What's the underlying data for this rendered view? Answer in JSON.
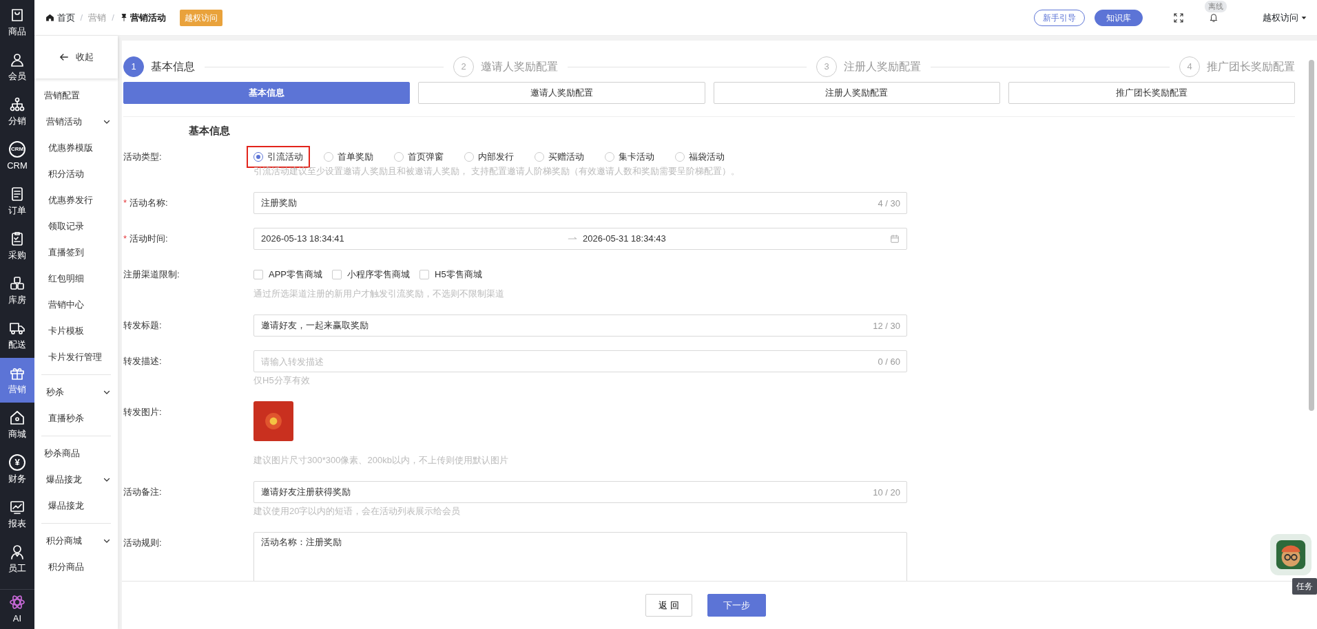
{
  "rail": {
    "items": [
      {
        "label": "商品",
        "selected": false
      },
      {
        "label": "会员",
        "selected": false
      },
      {
        "label": "分销",
        "selected": false
      },
      {
        "label": "CRM",
        "icon_text": "CRM",
        "selected": false
      },
      {
        "label": "订单",
        "selected": false
      },
      {
        "label": "采购",
        "selected": false
      },
      {
        "label": "库房",
        "selected": false
      },
      {
        "label": "配送",
        "selected": false
      },
      {
        "label": "营销",
        "selected": true
      },
      {
        "label": "商城",
        "selected": false
      },
      {
        "label": "财务",
        "icon_text": "¥",
        "selected": false
      },
      {
        "label": "报表",
        "selected": false
      },
      {
        "label": "员工",
        "selected": false
      }
    ],
    "ai": "AI"
  },
  "breadcrumb": {
    "separator": "/",
    "items": [
      {
        "label": "首页",
        "kind": "home"
      },
      {
        "label": "营销",
        "kind": "plain"
      },
      {
        "label": "营销活动",
        "kind": "current"
      }
    ],
    "badge": "越权访问"
  },
  "topbar": {
    "guide": "新手引导",
    "knowledge": "知识库",
    "status": "离线",
    "user": "越权访问"
  },
  "submenu": {
    "collapse": "收起",
    "items": [
      {
        "kind": "header",
        "label": "营销配置"
      },
      {
        "kind": "group",
        "label": "营销活动",
        "expanded": true,
        "children": [
          "优惠券模版",
          "积分活动",
          "优惠券发行",
          "领取记录",
          "直播签到",
          "红包明细",
          "营销中心",
          "卡片模板",
          "卡片发行管理"
        ]
      },
      {
        "kind": "group",
        "label": "秒杀",
        "expanded": true,
        "children": [
          "直播秒杀"
        ]
      },
      {
        "kind": "header",
        "label": "秒杀商品"
      },
      {
        "kind": "group",
        "label": "爆品接龙",
        "expanded": true,
        "children": [
          "爆品接龙"
        ]
      },
      {
        "kind": "group",
        "label": "积分商城",
        "expanded": true,
        "children": [
          "积分商品"
        ]
      }
    ]
  },
  "steps": [
    {
      "number": "1",
      "label": "基本信息",
      "selected": true
    },
    {
      "number": "2",
      "label": "邀请人奖励配置",
      "selected": false
    },
    {
      "number": "3",
      "label": "注册人奖励配置",
      "selected": false
    },
    {
      "number": "4",
      "label": "推广团长奖励配置",
      "selected": false
    }
  ],
  "tabs": [
    {
      "label": "基本信息",
      "selected": true
    },
    {
      "label": "邀请人奖励配置",
      "selected": false
    },
    {
      "label": "注册人奖励配置",
      "selected": false
    },
    {
      "label": "推广团长奖励配置",
      "selected": false
    }
  ],
  "section_title": "基本信息",
  "required_mark": "*",
  "fields": [
    {
      "kind": "radio",
      "label": "活动类型:",
      "required": false,
      "options": [
        {
          "label": "引流活动",
          "selected": true,
          "highlighted": true
        },
        {
          "label": "首单奖励",
          "selected": false,
          "highlighted": false
        },
        {
          "label": "首页弹窗",
          "selected": false,
          "highlighted": false
        },
        {
          "label": "内部发行",
          "selected": false,
          "highlighted": false
        },
        {
          "label": "买赠活动",
          "selected": false,
          "highlighted": false
        },
        {
          "label": "集卡活动",
          "selected": false,
          "highlighted": false
        },
        {
          "label": "福袋活动",
          "selected": false,
          "highlighted": false
        }
      ],
      "hint": "引流活动建议至少设置邀请人奖励且和被邀请人奖励， 支持配置邀请人阶梯奖励（有效邀请人数和奖励需要呈阶梯配置）。"
    },
    {
      "kind": "text",
      "label": "活动名称:",
      "required": true,
      "value": "注册奖励",
      "counter": "4 / 30"
    },
    {
      "kind": "daterange",
      "label": "活动时间:",
      "required": true,
      "start": "2026-05-13 18:34:41",
      "end": "2026-05-31 18:34:43"
    },
    {
      "kind": "checkbox",
      "label": "注册渠道限制:",
      "required": false,
      "options": [
        {
          "label": "APP零售商城",
          "checked": false
        },
        {
          "label": "小程序零售商城",
          "checked": false
        },
        {
          "label": "H5零售商城",
          "checked": false
        }
      ],
      "hint": "通过所选渠道注册的新用户才触发引流奖励，不选则不限制渠道"
    },
    {
      "kind": "text",
      "label": "转发标题:",
      "required": false,
      "value": "邀请好友，一起来赢取奖励",
      "counter": "12 / 30"
    },
    {
      "kind": "text",
      "label": "转发描述:",
      "required": false,
      "placeholder": "请输入转发描述",
      "counter": "0 / 60",
      "hint": "仅H5分享有效"
    },
    {
      "kind": "image",
      "label": "转发图片:",
      "required": false,
      "hint": "建议图片尺寸300*300像素、200kb以内，不上传则使用默认图片"
    },
    {
      "kind": "text",
      "label": "活动备注:",
      "required": false,
      "value": "邀请好友注册获得奖励",
      "counter": "10 / 20",
      "hint": "建议使用20字以内的短语，会在活动列表展示给会员"
    },
    {
      "kind": "textarea",
      "label": "活动规则:",
      "required": false,
      "lines": [
        "活动名称：注册奖励"
      ]
    }
  ],
  "footer": {
    "back": "返 回",
    "next": "下一步"
  },
  "float": {
    "task": "任务"
  }
}
